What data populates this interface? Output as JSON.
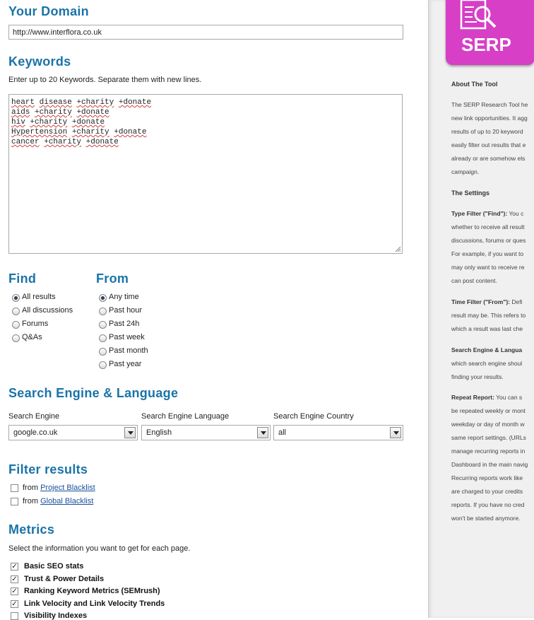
{
  "domain_section": {
    "title": "Your Domain",
    "value": "http://www.interflora.co.uk"
  },
  "keywords_section": {
    "title": "Keywords",
    "hint": "Enter up to 20 Keywords. Separate them with new lines.",
    "lines": [
      [
        "heart",
        "disease",
        "+charity",
        "+donate"
      ],
      [
        "aids",
        "+charity",
        "+donate"
      ],
      [
        "hiv",
        "+charity",
        "+donate"
      ],
      [
        "Hypertension",
        "+charity",
        "+donate"
      ],
      [
        "cancer",
        "+charity",
        "+donate"
      ]
    ]
  },
  "find": {
    "title": "Find",
    "options": [
      "All results",
      "All discussions",
      "Forums",
      "Q&As"
    ],
    "selected": "All results"
  },
  "from": {
    "title": "From",
    "options": [
      "Any time",
      "Past hour",
      "Past 24h",
      "Past week",
      "Past month",
      "Past year"
    ],
    "selected": "Any time"
  },
  "engine_section": {
    "title": "Search Engine & Language",
    "engine_label": "Search Engine",
    "engine_value": "google.co.uk",
    "language_label": "Search Engine Language",
    "language_value": "English",
    "country_label": "Search Engine Country",
    "country_value": "all"
  },
  "filter_section": {
    "title": "Filter results",
    "items": [
      {
        "prefix": "from",
        "link": "Project Blacklist"
      },
      {
        "prefix": "from",
        "link": "Global Blacklist"
      }
    ]
  },
  "metrics_section": {
    "title": "Metrics",
    "hint": "Select the information you want to get for each page.",
    "items": [
      {
        "label": "Basic SEO stats",
        "checked": true
      },
      {
        "label": "Trust & Power Details",
        "checked": true
      },
      {
        "label": "Ranking Keyword Metrics (SEMrush)",
        "checked": true
      },
      {
        "label": "Link Velocity and Link Velocity Trends",
        "checked": true
      },
      {
        "label": "Visibility Indexes",
        "checked": false
      }
    ]
  },
  "sidebar": {
    "logo_text": "SERP",
    "logo_color": "#d63fc6",
    "about_heading": "About The Tool",
    "about_lines": [
      "The SERP Research Tool he",
      "new link opportunities. It agg",
      "results of up to 20 keyword",
      "easily filter out results that e",
      "already or are somehow els",
      "campaign."
    ],
    "settings_heading": "The Settings",
    "type_filter_label": "Type Filter (\"Find\"):",
    "type_filter_lines": [
      "You c",
      "whether to receive all result",
      "discussions, forums or ques",
      "For example, if you want to",
      "may only want to receive re",
      "can post content."
    ],
    "time_filter_label": "Time Filter (\"From\"):",
    "time_filter_lines": [
      "Defi",
      "result may be. This refers to",
      "which a result was last che"
    ],
    "engine_label": "Search Engine & Langua",
    "engine_lines": [
      "which search engine shoul",
      "finding your results."
    ],
    "repeat_label": "Repeat Report:",
    "repeat_lines": [
      "You can s",
      "be repeated weekly or mont",
      "weekday or day of month w",
      "same report settings. (URLs",
      "manage recurring reports in",
      "Dashboard in the main navig",
      "Recurring reports work like",
      "are charged to your credits",
      "reports. If you have no cred",
      "won't be started anymore."
    ]
  }
}
